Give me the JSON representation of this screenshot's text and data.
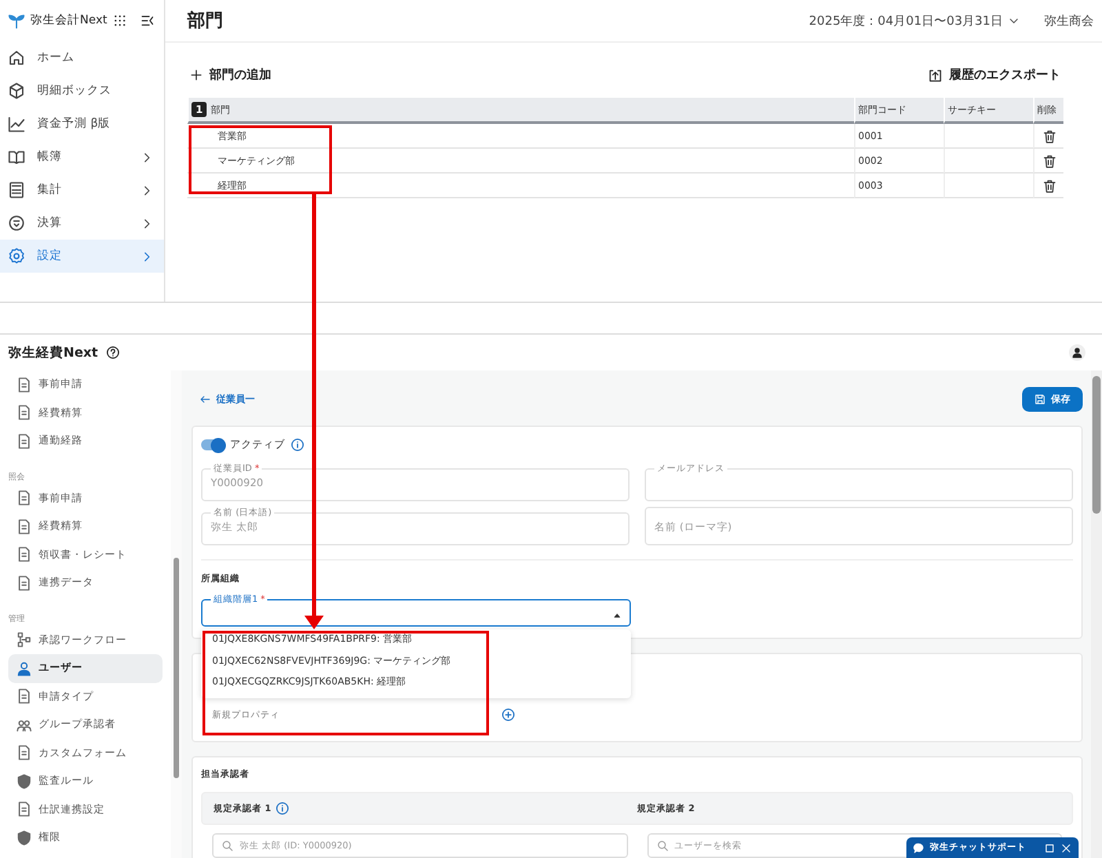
{
  "top_app": {
    "logo": "弥生会計Next",
    "page_title": "部門",
    "fiscal_period": "2025年度：04月01日〜03月31日",
    "company": "弥生商会",
    "sidebar": {
      "items": [
        {
          "label": "ホーム",
          "expandable": false,
          "selected": false
        },
        {
          "label": "明細ボックス",
          "expandable": false,
          "selected": false
        },
        {
          "label": "資金予測 β版",
          "expandable": false,
          "selected": false
        },
        {
          "label": "帳簿",
          "expandable": true,
          "selected": false
        },
        {
          "label": "集計",
          "expandable": true,
          "selected": false
        },
        {
          "label": "決算",
          "expandable": true,
          "selected": false
        },
        {
          "label": "設定",
          "expandable": true,
          "selected": true
        }
      ]
    },
    "add_button": "部門の追加",
    "export_button": "履歴のエクスポート",
    "table": {
      "sort_badge": "1",
      "columns": [
        "部門",
        "部門コード",
        "サーチキー",
        "削除"
      ],
      "rows": [
        {
          "name": "営業部",
          "code": "0001"
        },
        {
          "name": "マーケティング部",
          "code": "0002"
        },
        {
          "name": "経理部",
          "code": "0003"
        }
      ]
    }
  },
  "bottom_app": {
    "logo": "弥生経費Next",
    "sidebar": {
      "sections": [
        {
          "items": [
            {
              "label": "事前申請",
              "selected": false
            },
            {
              "label": "経費精算",
              "selected": false
            },
            {
              "label": "通勤経路",
              "selected": false
            }
          ]
        },
        {
          "title": "照会",
          "items": [
            {
              "label": "事前申請",
              "selected": false
            },
            {
              "label": "経費精算",
              "selected": false
            },
            {
              "label": "領収書・レシート",
              "selected": false
            },
            {
              "label": "連携データ",
              "selected": false
            }
          ]
        },
        {
          "title": "管理",
          "items": [
            {
              "label": "承認ワークフロー",
              "selected": false
            },
            {
              "label": "ユーザー",
              "selected": true
            },
            {
              "label": "申請タイプ",
              "selected": false
            },
            {
              "label": "グループ承認者",
              "selected": false
            },
            {
              "label": "カスタムフォーム",
              "selected": false
            },
            {
              "label": "監査ルール",
              "selected": false
            },
            {
              "label": "仕訳連携設定",
              "selected": false
            },
            {
              "label": "権限",
              "selected": false
            }
          ]
        }
      ]
    },
    "back_link": "従業員一",
    "save_button": "保存",
    "active_toggle": {
      "label": "アクティブ",
      "on": true
    },
    "fields": [
      {
        "label": "従業員ID",
        "required_mark": "*",
        "value": "Y0000920"
      },
      {
        "label": "メールアドレス"
      },
      {
        "label": "名前 (日本語)",
        "value": "弥生 太郎"
      },
      {
        "placeholder": "名前 (ローマ字)"
      }
    ],
    "organization": {
      "title": "所属組織",
      "select": {
        "label": "組織階層1",
        "required_mark": "*",
        "expanded": true
      },
      "options": [
        {
          "label": "01JQXE8KGNS7WMFS49FA1BPRF9: 営業部",
          "selected": false
        },
        {
          "label": "01JQXEC62NS8FVEVJHTF369J9G: マーケティング部",
          "selected": false
        },
        {
          "label": "01JQXECGQZRKC9JSJTK60AB5KH: 経理部",
          "selected": false
        }
      ]
    },
    "new_property": "新規プロパティ",
    "approvers": {
      "title": "担当承認者",
      "columns": [
        {
          "label": "規定承認者 1",
          "info": true
        },
        {
          "label": "規定承認者 2",
          "info": false
        }
      ],
      "search_fields": [
        {
          "value": "弥生 太郎 (ID: Y0000920)"
        },
        {
          "placeholder": "ユーザーを検索"
        }
      ]
    },
    "chat_widget": "弥生チャットサポート"
  }
}
